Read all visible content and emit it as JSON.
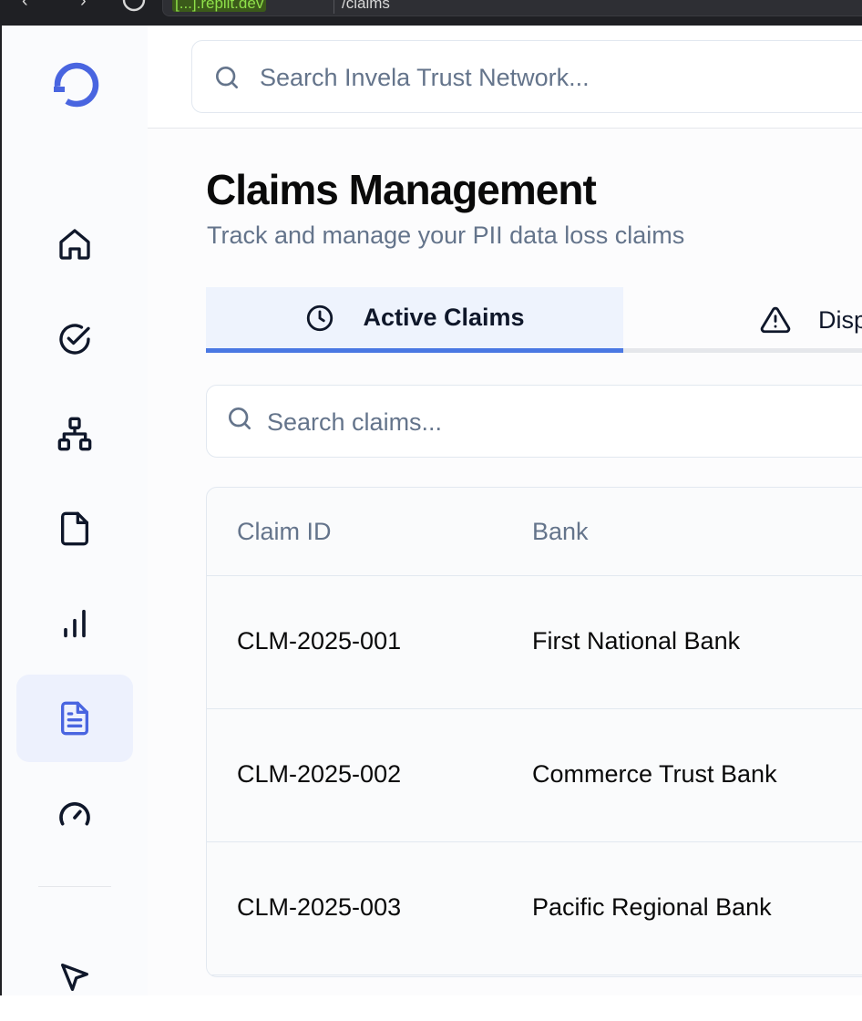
{
  "browser": {
    "host": "[...].replit.dev",
    "path": "/claims"
  },
  "topbar": {
    "search_placeholder": "Search Invela Trust Network..."
  },
  "sidebar": {
    "items": [
      {
        "icon": "home-icon",
        "active": false
      },
      {
        "icon": "check-circle-icon",
        "active": false
      },
      {
        "icon": "network-icon",
        "active": false
      },
      {
        "icon": "file-icon",
        "active": false
      },
      {
        "icon": "bar-chart-icon",
        "active": false
      },
      {
        "icon": "file-text-icon",
        "active": true
      },
      {
        "icon": "gauge-icon",
        "active": false
      },
      {
        "icon": "cursor-icon",
        "active": false
      }
    ]
  },
  "page": {
    "title": "Claims Management",
    "subtitle": "Track and manage your PII data loss claims"
  },
  "tabs": [
    {
      "label": "Active Claims",
      "icon": "clock-icon",
      "active": true
    },
    {
      "label": "Disp",
      "icon": "alert-triangle-icon",
      "active": false
    }
  ],
  "claims_search": {
    "placeholder": "Search claims..."
  },
  "table": {
    "headers": [
      "Claim ID",
      "Bank"
    ],
    "rows": [
      {
        "claim_id": "CLM-2025-001",
        "bank": "First National Bank"
      },
      {
        "claim_id": "CLM-2025-002",
        "bank": "Commerce Trust Bank"
      },
      {
        "claim_id": "CLM-2025-003",
        "bank": "Pacific Regional Bank"
      }
    ]
  },
  "colors": {
    "accent": "#4a78e3",
    "active_bg": "#edf1fd",
    "url_green": "#7ed321"
  }
}
